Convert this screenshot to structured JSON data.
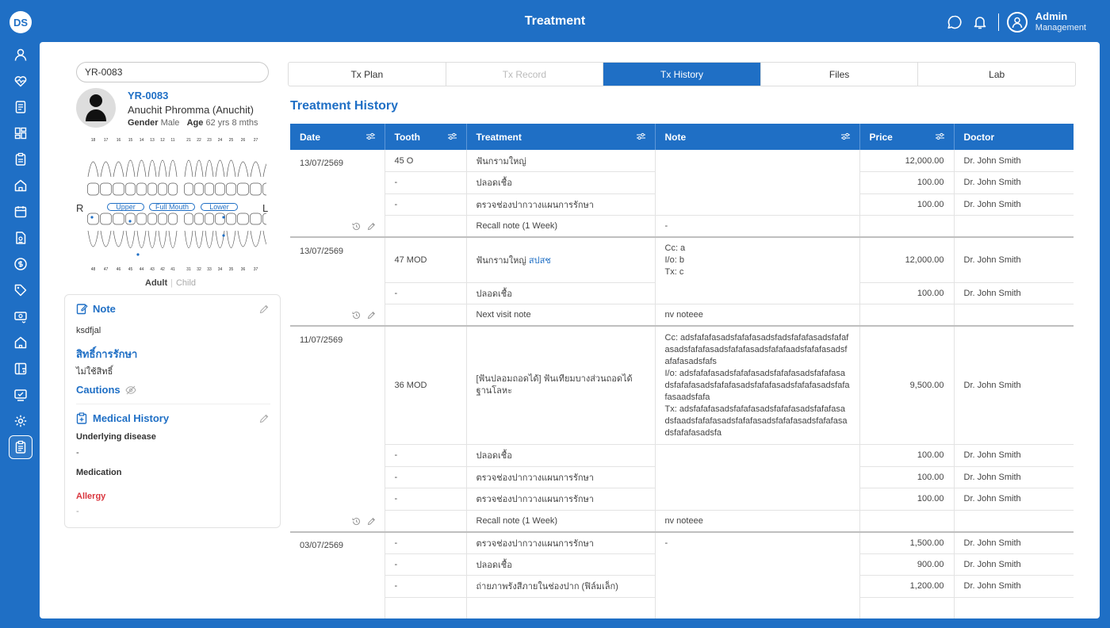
{
  "app": {
    "title": "Treatment",
    "logo_text": "DS"
  },
  "user": {
    "name": "Admin",
    "role": "Management"
  },
  "patient": {
    "search_value": "YR-0083",
    "id": "YR-0083",
    "name": "Anuchit Phromma (Anuchit)",
    "gender_label": "Gender",
    "gender": "Male",
    "age_label": "Age",
    "age": "62 yrs 8 mths"
  },
  "dental_chart": {
    "upper_numbers": [
      "18",
      "17",
      "16",
      "15",
      "14",
      "13",
      "12",
      "11",
      "21",
      "22",
      "23",
      "24",
      "25",
      "26",
      "27",
      "28"
    ],
    "lower_numbers": [
      "48",
      "47",
      "46",
      "45",
      "44",
      "43",
      "42",
      "41",
      "31",
      "32",
      "33",
      "34",
      "35",
      "36",
      "37",
      "38"
    ],
    "side_right": "R",
    "side_left": "L",
    "pills": [
      "Upper",
      "Full Mouth",
      "Lower"
    ],
    "mode_adult": "Adult",
    "mode_child": "Child"
  },
  "info": {
    "note_title": "Note",
    "note_text": "ksdfjal",
    "rights_title": "สิทธิ์การรักษา",
    "rights_text": "ไม่ใช้สิทธิ์",
    "cautions_title": "Cautions",
    "medical_title": "Medical History",
    "underlying_label": "Underlying disease",
    "underlying_value": "-",
    "medication_label": "Medication",
    "allergy_label": "Allergy",
    "allergy_value": "-"
  },
  "tabs": [
    "Tx Plan",
    "Tx Record",
    "Tx History",
    "Files",
    "Lab"
  ],
  "section_title": "Treatment History",
  "columns": [
    "Date",
    "Tooth",
    "Treatment",
    "Note",
    "Price",
    "Doctor"
  ],
  "groups": [
    {
      "date": "13/07/2569",
      "rows": [
        {
          "tooth": "45 O",
          "treatment": "ฟันกรามใหญ่",
          "price": "12,000.00",
          "doctor": "Dr. John Smith"
        },
        {
          "tooth": "-",
          "treatment": "ปลอดเชื้อ",
          "price": "100.00",
          "doctor": "Dr. John Smith"
        },
        {
          "tooth": "-",
          "treatment": "ตรวจช่องปากวางแผนการรักษา",
          "price": "100.00",
          "doctor": "Dr. John Smith"
        }
      ],
      "note": "",
      "recall": {
        "label": "Recall note (1 Week)",
        "note": "-"
      }
    },
    {
      "date": "13/07/2569",
      "rows": [
        {
          "tooth": "47 MOD",
          "treatment": "ฟันกรามใหญ่",
          "treatment_extra": "สปสช",
          "price": "12,000.00",
          "doctor": "Dr. John Smith"
        },
        {
          "tooth": "-",
          "treatment": "ปลอดเชื้อ",
          "price": "100.00",
          "doctor": "Dr. John Smith"
        }
      ],
      "note_lines": [
        "Cc: a",
        "I/o: b",
        "Tx: c"
      ],
      "recall": {
        "label": "Next visit note",
        "note": "nv noteee"
      }
    },
    {
      "date": "11/07/2569",
      "rows": [
        {
          "tooth": "36 MOD",
          "treatment": "[ฟันปลอมถอดได้] ฟันเทียมบางส่วนถอดได้ ฐานโลหะ",
          "price": "9,500.00",
          "doctor": "Dr. John Smith"
        },
        {
          "tooth": "-",
          "treatment": "ปลอดเชื้อ",
          "price": "100.00",
          "doctor": "Dr. John Smith"
        },
        {
          "tooth": "-",
          "treatment": "ตรวจช่องปากวางแผนการรักษา",
          "price": "100.00",
          "doctor": "Dr. John Smith"
        },
        {
          "tooth": "-",
          "treatment": "ตรวจช่องปากวางแผนการรักษา",
          "price": "100.00",
          "doctor": "Dr. John Smith"
        }
      ],
      "note_lines": [
        "Cc: adsfafafasadsfafafasadsfadsfafafasadsfafafasadsfafafasadsfafafasadsfafafaadsfafafasadsfafafasadsfafs",
        "I/o: adsfafafasadsfafafasadsfafafasadsfafafasadsfafafasadsfafafasadsfafafasadsfafafasadsfafafasaadsfafa",
        "Tx: adsfafafasadsfafafasadsfafafasadsfafafasadsfaadsfafafasadsfafafasadsfafafasadsfafafasadsfafafasadsfa"
      ],
      "recall": {
        "label": "Recall note (1 Week)",
        "note": "nv noteee"
      }
    },
    {
      "date": "03/07/2569",
      "rows": [
        {
          "tooth": "-",
          "treatment": "ตรวจช่องปากวางแผนการรักษา",
          "price": "1,500.00",
          "doctor": "Dr. John Smith"
        },
        {
          "tooth": "-",
          "treatment": "ปลอดเชื้อ",
          "price": "900.00",
          "doctor": "Dr. John Smith"
        },
        {
          "tooth": "-",
          "treatment": "ถ่ายภาพรังสีภายในช่องปาก (ฟิล์มเล็ก)",
          "price": "1,200.00",
          "doctor": "Dr. John Smith"
        }
      ],
      "note": "-"
    }
  ],
  "colors": {
    "primary": "#1f6fc5",
    "allergy": "#d9363e"
  },
  "sidebar_icons": [
    "user-icon",
    "heart-pulse-icon",
    "document-icon",
    "dashboard-icon",
    "clipboard-icon",
    "clinic-icon",
    "calendar-icon",
    "file-report-icon",
    "coin-icon",
    "tag-icon",
    "cash-icon",
    "building-icon",
    "layout-icon",
    "monitor-check-icon",
    "settings-icon",
    "treatment-icon"
  ]
}
